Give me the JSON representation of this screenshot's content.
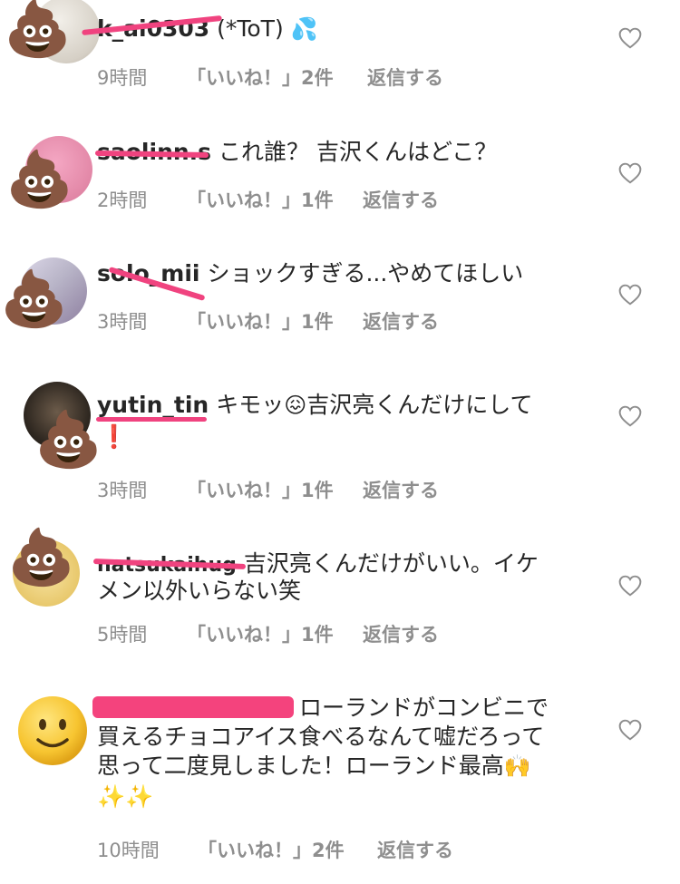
{
  "comments": [
    {
      "username": "k_ai0303",
      "text": "(*ToT)",
      "emoji": "💦",
      "time": "9時間",
      "likes": "「いいね！」2件",
      "reply": "返信する"
    },
    {
      "username": "saolinn.s",
      "text": "これ誰？ 吉沢くんはどこ？",
      "time": "2時間",
      "likes": "「いいね！」1件",
      "reply": "返信する"
    },
    {
      "username": "solo_mii",
      "text": "ショックすぎる...やめてほしい",
      "time": "3時間",
      "likes": "「いいね！」1件",
      "reply": "返信する"
    },
    {
      "username": "yutin_tin",
      "text_before": "キモッ",
      "emoji": "😖",
      "text_after": "吉沢亮くんだけにして",
      "line2": "❗",
      "time": "3時間",
      "likes": "「いいね！」1件",
      "reply": "返信する"
    },
    {
      "username": "natsukaihug",
      "text_line1": "吉沢亮くんだけがいい。イケ",
      "text_line2": "メン以外いらない笑",
      "time": "5時間",
      "likes": "「いいね！」1件",
      "reply": "返信する"
    },
    {
      "text_line1": "ローランドがコンビニで",
      "text_line2": "買えるチョコアイス食べるなんて嘘だろって",
      "text_line3": "思って二度見しました！ローランド最高",
      "emoji_hands": "🙌",
      "text_line4": "✨✨",
      "time": "10時間",
      "likes": "「いいね！」2件",
      "reply": "返信する"
    }
  ],
  "icons": {
    "poo": "💩",
    "smile": "🙂",
    "heart": "heart-outline-icon"
  },
  "colors": {
    "text": "#262626",
    "meta": "#8e8e8e",
    "redaction": "#f0437f"
  }
}
